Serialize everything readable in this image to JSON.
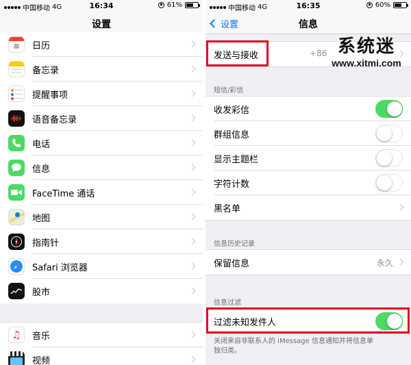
{
  "left": {
    "status": {
      "carrier": "中国移动",
      "network": "4G",
      "time": "16:34",
      "battery": "61%",
      "battery_level": 0.61
    },
    "nav_title": "设置",
    "group1": [
      {
        "label": "日历",
        "icon": "calendar-icon"
      },
      {
        "label": "备忘录",
        "icon": "notes-icon"
      },
      {
        "label": "提醒事项",
        "icon": "reminders-icon"
      },
      {
        "label": "语音备忘录",
        "icon": "voice-memos-icon"
      },
      {
        "label": "电话",
        "icon": "phone-icon"
      },
      {
        "label": "信息",
        "icon": "messages-icon"
      },
      {
        "label": "FaceTime 通话",
        "icon": "facetime-icon"
      },
      {
        "label": "地图",
        "icon": "maps-icon"
      },
      {
        "label": "指南针",
        "icon": "compass-icon"
      },
      {
        "label": "Safari 浏览器",
        "icon": "safari-icon"
      },
      {
        "label": "股市",
        "icon": "stocks-icon"
      }
    ],
    "group2": [
      {
        "label": "音乐",
        "icon": "music-icon"
      },
      {
        "label": "视频",
        "icon": "videos-icon"
      }
    ]
  },
  "right": {
    "status": {
      "carrier": "中国移动",
      "network": "4G",
      "time": "16:35",
      "battery": "60%",
      "battery_level": 0.6
    },
    "back_label": "设置",
    "nav_title": "信息",
    "send_receive": {
      "label": "发送与接收",
      "value": "+86"
    },
    "section_sms": "短信/彩信",
    "sms_rows": [
      {
        "label": "收发彩信",
        "toggle": "on"
      },
      {
        "label": "群组信息",
        "toggle": "off"
      },
      {
        "label": "显示主题栏",
        "toggle": "off"
      },
      {
        "label": "字符计数",
        "toggle": "off"
      },
      {
        "label": "黑名单",
        "toggle": "chevron"
      }
    ],
    "section_history": "信息历史记录",
    "keep_messages": {
      "label": "保留信息",
      "value": "永久"
    },
    "section_filter": "信息过滤",
    "filter_unknown": {
      "label": "过滤未知发件人",
      "toggle": "on"
    },
    "filter_footnote": "关闭来自非联系人的 iMessage 信息通知并将信息单独归类。"
  },
  "watermark": {
    "logo": "系统迷",
    "url": "www.xitmi.com"
  },
  "colors": {
    "accent": "#007aff",
    "toggle_on": "#4cd964",
    "highlight_box": "#e3001b"
  }
}
